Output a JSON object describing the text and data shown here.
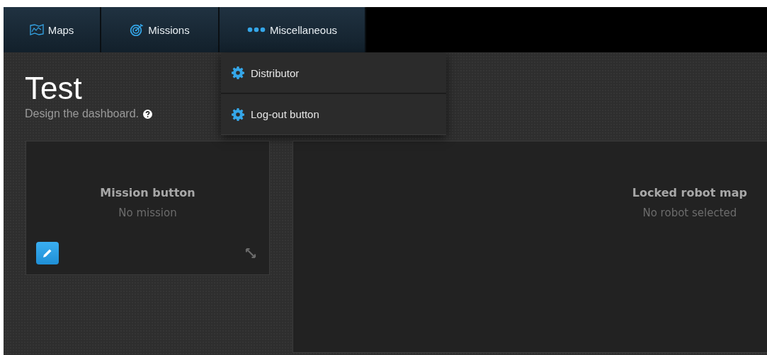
{
  "nav": {
    "tabs": [
      {
        "label": "Maps"
      },
      {
        "label": "Missions"
      },
      {
        "label": "Miscellaneous"
      }
    ]
  },
  "dropdown": {
    "items": [
      {
        "label": "Distributor"
      },
      {
        "label": "Log-out button"
      }
    ]
  },
  "header": {
    "title": "Test",
    "subtitle": "Design the dashboard."
  },
  "widgets": [
    {
      "title": "Mission button",
      "status": "No mission",
      "editable": true
    },
    {
      "title": "Locked robot map",
      "status": "No robot selected",
      "editable": false
    }
  ]
}
